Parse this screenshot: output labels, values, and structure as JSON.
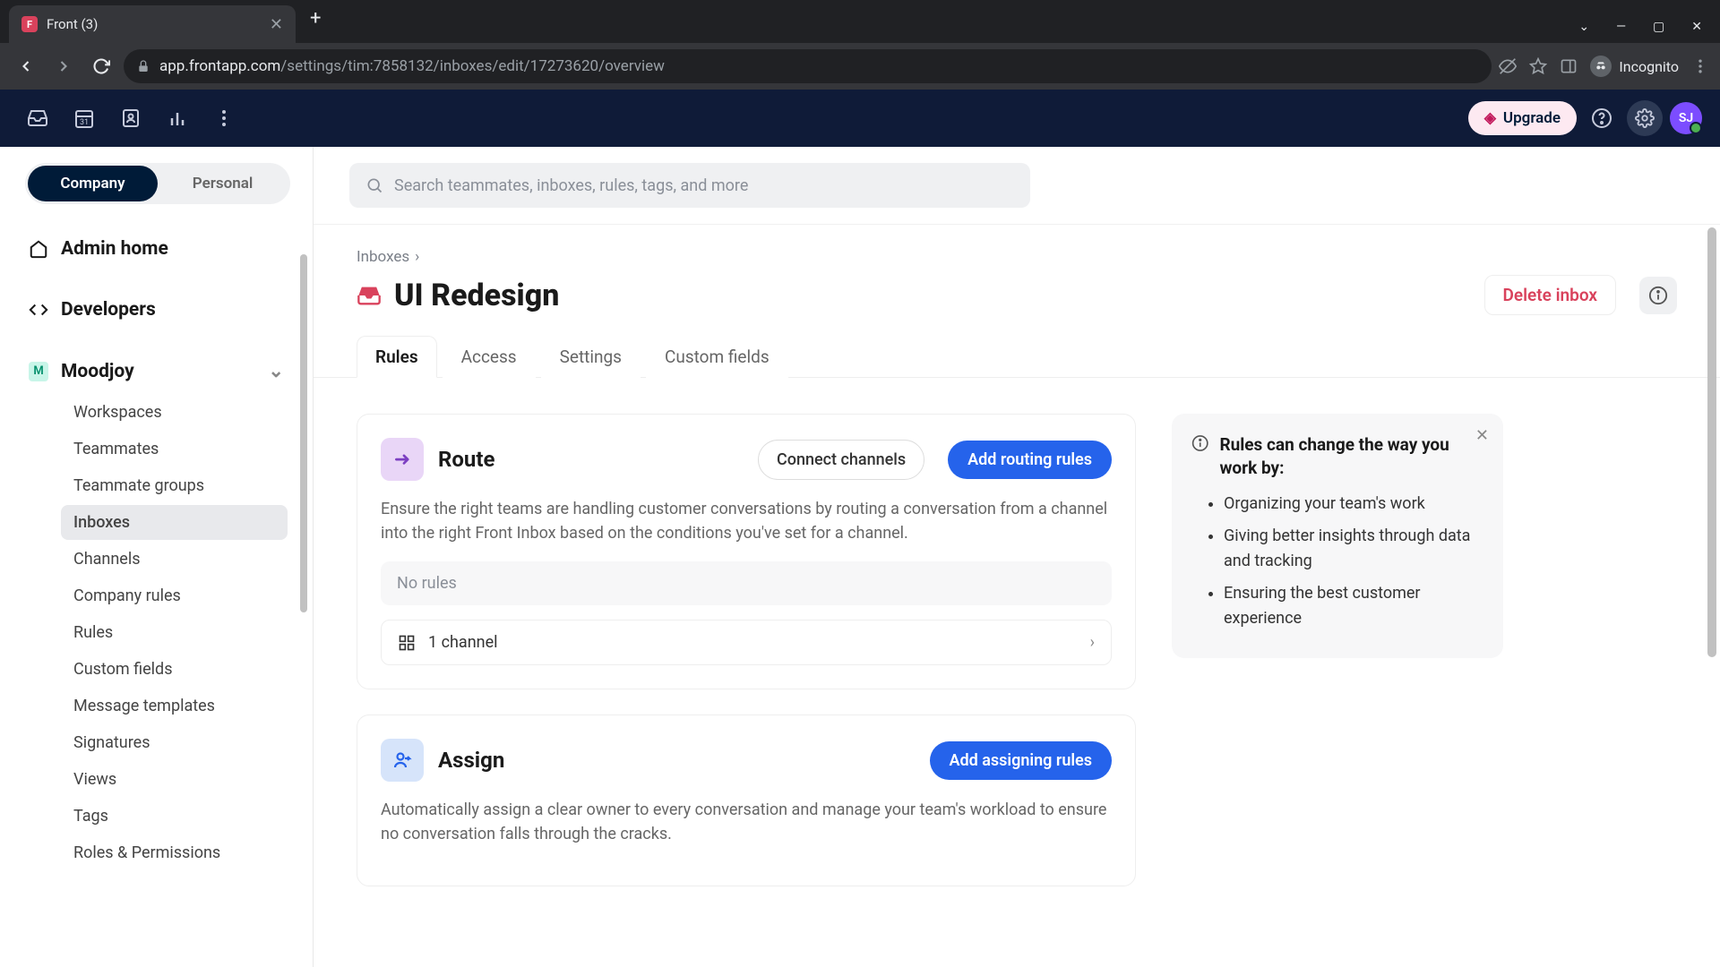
{
  "browser": {
    "tab_title": "Front (3)",
    "url_host": "app.frontapp.com",
    "url_path": "/settings/tim:7858132/inboxes/edit/17273620/overview",
    "incognito_label": "Incognito"
  },
  "header": {
    "upgrade_label": "Upgrade",
    "avatar_initials": "SJ"
  },
  "sidebar": {
    "toggle": {
      "company": "Company",
      "personal": "Personal"
    },
    "admin_home": "Admin home",
    "developers": "Developers",
    "group_name": "Moodjoy",
    "subitems": [
      "Workspaces",
      "Teammates",
      "Teammate groups",
      "Inboxes",
      "Channels",
      "Company rules",
      "Rules",
      "Custom fields",
      "Message templates",
      "Signatures",
      "Views",
      "Tags",
      "Roles & Permissions"
    ],
    "active_subitem_index": 3
  },
  "search": {
    "placeholder": "Search teammates, inboxes, rules, tags, and more"
  },
  "breadcrumb": {
    "root": "Inboxes"
  },
  "page": {
    "title": "UI Redesign",
    "delete_label": "Delete inbox",
    "tabs": [
      "Rules",
      "Access",
      "Settings",
      "Custom fields"
    ],
    "active_tab_index": 0
  },
  "route_card": {
    "title": "Route",
    "connect_label": "Connect channels",
    "add_label": "Add routing rules",
    "description": "Ensure the right teams are handling customer conversations by routing a conversation from a channel into the right Front Inbox based on the conditions you've set for a channel.",
    "no_rules_label": "No rules",
    "channel_label": "1 channel"
  },
  "assign_card": {
    "title": "Assign",
    "add_label": "Add assigning rules",
    "description": "Automatically assign a clear owner to every conversation and manage your team's workload to ensure no conversation falls through the cracks."
  },
  "info_panel": {
    "title": "Rules can change the way you work by:",
    "bullets": [
      "Organizing your team's work",
      "Giving better insights through data and tracking",
      "Ensuring the best customer experience"
    ]
  }
}
